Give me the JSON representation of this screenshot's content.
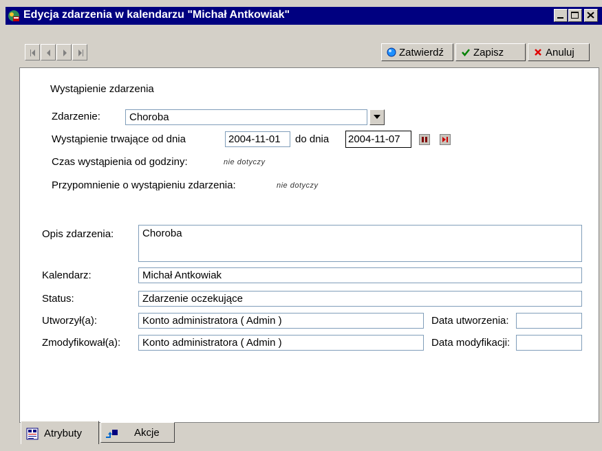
{
  "window": {
    "title": "Edycja zdarzenia w kalendarzu \"Michał Antkowiak\"",
    "controls": {
      "minimize": "minimize-icon",
      "maximize": "maximize-icon",
      "close": "close-icon"
    }
  },
  "toolbar": {
    "nav_icons": [
      "first-record-icon",
      "prev-record-icon",
      "next-record-icon",
      "last-record-icon"
    ],
    "confirm_label": "Zatwierdź",
    "save_label": "Zapisz",
    "cancel_label": "Anuluj"
  },
  "occurrence": {
    "section_title": "Wystąpienie zdarzenia",
    "event_label": "Zdarzenie:",
    "event_value": "Choroba",
    "range_label": "Wystąpienie trwające od dnia",
    "date_from": "2004-11-01",
    "to_label": "do dnia",
    "date_to": "2004-11-07",
    "time_label": "Czas wystąpienia od godziny:",
    "time_value": "nie dotyczy",
    "reminder_label": "Przypomnienie o wystąpieniu zdarzenia:",
    "reminder_value": "nie dotyczy"
  },
  "details": {
    "description_label": "Opis zdarzenia:",
    "description_value": "Choroba",
    "calendar_label": "Kalendarz:",
    "calendar_value": "Michał Antkowiak",
    "status_label": "Status:",
    "status_value": "Zdarzenie oczekujące",
    "created_by_label": "Utworzył(a):",
    "created_by_value": "Konto administratora ( Admin )",
    "created_date_label": "Data utworzenia:",
    "created_date_value": "",
    "modified_by_label": "Zmodyfikował(a):",
    "modified_by_value": "Konto administratora ( Admin )",
    "modified_date_label": "Data modyfikacji:",
    "modified_date_value": ""
  },
  "tabs": [
    {
      "label": "Atrybuty",
      "icon": "attributes-icon",
      "active": true
    },
    {
      "label": "Akcje",
      "icon": "actions-icon",
      "active": false
    }
  ],
  "colors": {
    "titlebar": "#000080",
    "confirm_dot": "#1e90ff",
    "save_check": "#008000",
    "cancel_x": "#e00000"
  }
}
